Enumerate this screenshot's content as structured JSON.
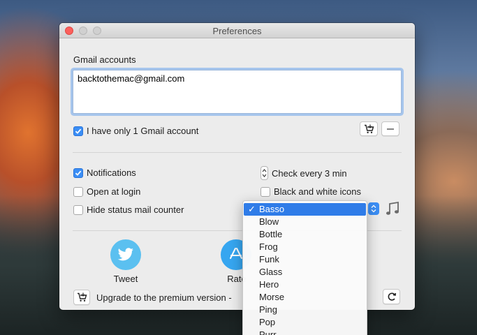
{
  "window": {
    "title": "Preferences"
  },
  "accounts": {
    "section_label": "Gmail accounts",
    "value": "backtothemac@gmail.com",
    "only_one_label": "I have only 1 Gmail account",
    "only_one_checked": true
  },
  "options": {
    "notifications_label": "Notifications",
    "notifications_checked": true,
    "open_at_login_label": "Open at login",
    "open_at_login_checked": false,
    "hide_counter_label": "Hide status mail counter",
    "hide_counter_checked": false,
    "check_every_label": "Check every 3 min",
    "bw_icons_label": "Black and white icons",
    "bw_icons_checked": false
  },
  "sound_menu": {
    "selected": "Basso",
    "items": [
      "Basso",
      "Blow",
      "Bottle",
      "Frog",
      "Funk",
      "Glass",
      "Hero",
      "Morse",
      "Ping",
      "Pop",
      "Purr"
    ]
  },
  "footer": {
    "tweet_label": "Tweet",
    "rate_label": "Rate",
    "upgrade_text": "Upgrade to the premium version -"
  },
  "icons": {
    "cart": "cart-icon",
    "minus": "minus-icon",
    "music": "music-note-icon",
    "twitter": "twitter-icon",
    "appstore": "app-store-icon",
    "refresh": "refresh-icon"
  },
  "colors": {
    "accent": "#3b8ef5",
    "menu_selected": "#2f7ce8",
    "close_button": "#fc605c",
    "twitter": "#5bc0f0"
  }
}
